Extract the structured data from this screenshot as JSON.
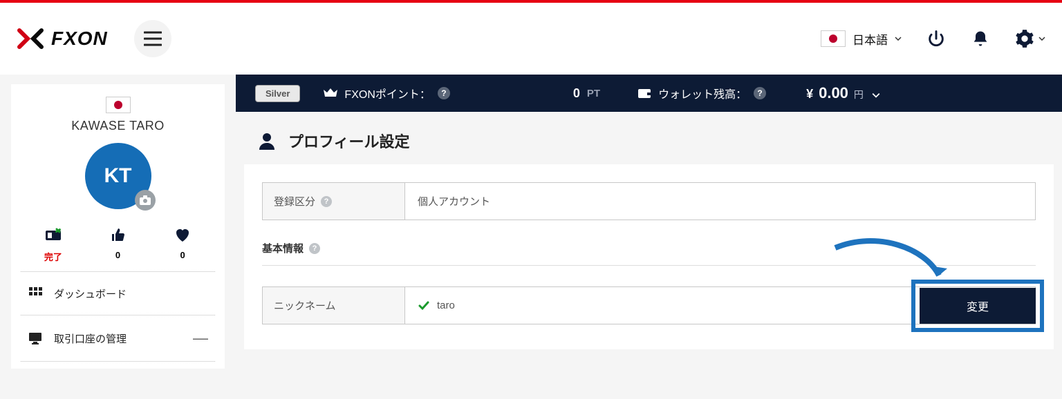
{
  "header": {
    "brand_text": "FXON",
    "language_label": "日本語"
  },
  "sidebar": {
    "user_name": "KAWASE TARO",
    "avatar_initials": "KT",
    "stats": {
      "verify_label": "完了",
      "likes_count": "0",
      "favorites_count": "0"
    },
    "nav": {
      "dashboard": "ダッシュボード",
      "accounts": "取引口座の管理"
    }
  },
  "topstrip": {
    "tier": "Silver",
    "points_label": "FXONポイント：",
    "points_value": "0",
    "points_unit": "PT",
    "wallet_label": "ウォレット残高：",
    "wallet_currency_symbol": "¥",
    "wallet_amount": "0.00",
    "wallet_currency_unit": "円"
  },
  "page": {
    "title": "プロフィール設定",
    "reg_type_label": "登録区分",
    "reg_type_value": "個人アカウント",
    "basic_info_heading": "基本情報",
    "nickname_label": "ニックネーム",
    "nickname_value": "taro",
    "change_button": "変更"
  }
}
